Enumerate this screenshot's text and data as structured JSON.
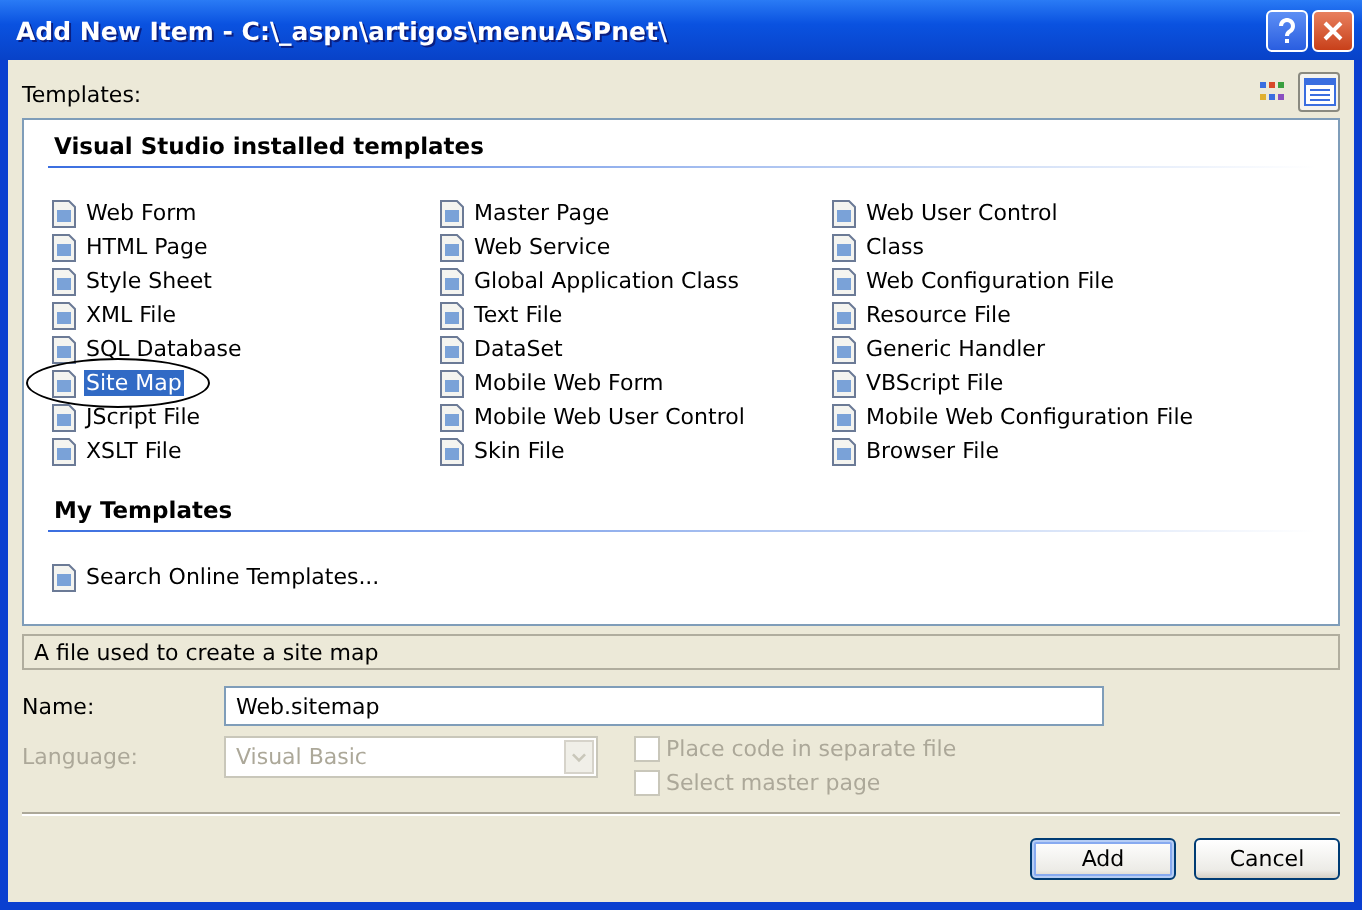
{
  "window": {
    "title": "Add New Item - C:\\_aspn\\artigos\\menuASPnet\\"
  },
  "templates_label": "Templates:",
  "view_buttons": [
    {
      "kind": "large-icons",
      "selected": false
    },
    {
      "kind": "small-icons",
      "selected": true
    }
  ],
  "groups": [
    {
      "title": "Visual Studio installed templates",
      "items": [
        {
          "label": "Web Form",
          "selected": false,
          "circled": false
        },
        {
          "label": "Master Page",
          "selected": false,
          "circled": false
        },
        {
          "label": "Web User Control",
          "selected": false,
          "circled": false
        },
        {
          "label": "HTML Page",
          "selected": false,
          "circled": false
        },
        {
          "label": "Web Service",
          "selected": false,
          "circled": false
        },
        {
          "label": "Class",
          "selected": false,
          "circled": false
        },
        {
          "label": "Style Sheet",
          "selected": false,
          "circled": false
        },
        {
          "label": "Global Application Class",
          "selected": false,
          "circled": false
        },
        {
          "label": "Web Configuration File",
          "selected": false,
          "circled": false
        },
        {
          "label": "XML File",
          "selected": false,
          "circled": false
        },
        {
          "label": "Text File",
          "selected": false,
          "circled": false
        },
        {
          "label": "Resource File",
          "selected": false,
          "circled": false
        },
        {
          "label": "SQL Database",
          "selected": false,
          "circled": false
        },
        {
          "label": "DataSet",
          "selected": false,
          "circled": false
        },
        {
          "label": "Generic Handler",
          "selected": false,
          "circled": false
        },
        {
          "label": "Site Map",
          "selected": true,
          "circled": true
        },
        {
          "label": "Mobile Web Form",
          "selected": false,
          "circled": false
        },
        {
          "label": "VBScript File",
          "selected": false,
          "circled": false
        },
        {
          "label": "JScript File",
          "selected": false,
          "circled": false
        },
        {
          "label": "Mobile Web User Control",
          "selected": false,
          "circled": false
        },
        {
          "label": "Mobile Web Configuration File",
          "selected": false,
          "circled": false
        },
        {
          "label": "XSLT File",
          "selected": false,
          "circled": false
        },
        {
          "label": "Skin File",
          "selected": false,
          "circled": false
        },
        {
          "label": "Browser File",
          "selected": false,
          "circled": false
        }
      ]
    },
    {
      "title": "My Templates",
      "items": [
        {
          "label": "Search Online Templates...",
          "selected": false,
          "circled": false
        }
      ]
    }
  ],
  "description": "A file used to create a site map",
  "name_field": {
    "label": "Name:",
    "value": "Web.sitemap"
  },
  "language": {
    "label": "Language:",
    "value": "Visual Basic",
    "disabled": true
  },
  "options": [
    {
      "label": "Place code in separate file",
      "checked": false,
      "disabled": true
    },
    {
      "label": "Select master page",
      "checked": false,
      "disabled": true
    }
  ],
  "buttons": [
    {
      "label": "Add",
      "default": true
    },
    {
      "label": "Cancel",
      "default": false
    }
  ]
}
